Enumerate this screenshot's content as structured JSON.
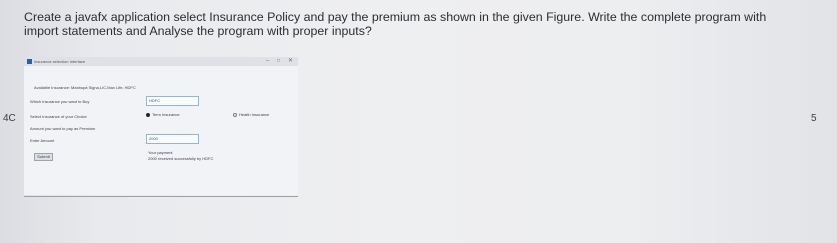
{
  "question": {
    "text": "Create a javafx application select Insurance Policy and pay the premium as shown in the given Figure. Write the complete program with import statements and Analyse the program with proper inputs?"
  },
  "margin": {
    "left_label": "4C",
    "right_label": "5"
  },
  "window": {
    "title": "Insurance selection Interface",
    "min_symbol": "–",
    "max_symbol": "□",
    "close_symbol": "✕"
  },
  "form": {
    "available_label": "Available Insurance: Maxbupa Signa,LIC,Max Life, HDFC",
    "which_label": "Which Insurance you want to Buy",
    "which_value": "HDFC",
    "select_label": "Select Insurance of your Choice",
    "options": [
      {
        "label": "Term Insurance",
        "selected": true
      },
      {
        "label": "Health Insurance",
        "selected": false
      }
    ],
    "amount_label": "Amount you want to pay as Premium",
    "enter_label": "Enter Amount",
    "amount_value": "2000",
    "submit_label": "Submit",
    "result_line1": "Your payment",
    "result_line2": "2000 received successfully by HDFC"
  }
}
